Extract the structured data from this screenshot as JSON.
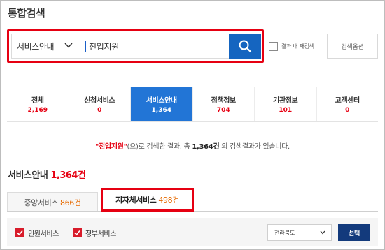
{
  "header": {
    "title": "통합검색"
  },
  "search": {
    "category_label": "서비스안내",
    "query_value": "전입지원",
    "recheck_label": "결과 내 재검색",
    "options_label": "검색옵션"
  },
  "category_tabs": [
    {
      "label": "전체",
      "count": "2,169",
      "active": false
    },
    {
      "label": "신청서비스",
      "count": "0",
      "active": false
    },
    {
      "label": "서비스안내",
      "count": "1,364",
      "active": true
    },
    {
      "label": "정책정보",
      "count": "704",
      "active": false
    },
    {
      "label": "기관정보",
      "count": "101",
      "active": false
    },
    {
      "label": "고객센터",
      "count": "0",
      "active": false
    }
  ],
  "result_message": {
    "keyword": "\"전입지원\"",
    "part1": "(으)로 검색한 결과, 총 ",
    "total": "1,364건",
    "part2": " 의 검색결과가 있습니다."
  },
  "section": {
    "title": "서비스안내",
    "count": "1,364건"
  },
  "sub_tabs": [
    {
      "label": "중앙서비스",
      "count": "866건",
      "active": false
    },
    {
      "label": "지자체서비스",
      "count": "498건",
      "active": true
    }
  ],
  "filters": {
    "civil_label": "민원서비스",
    "gov_label": "정부서비스",
    "region_value": "전라북도",
    "select_label": "선택"
  },
  "colors": {
    "accent_blue": "#2275d6",
    "search_button": "#1565c0",
    "highlight_red": "#e60012",
    "count_orange": "#e66a00",
    "select_button_navy": "#133a7c"
  }
}
